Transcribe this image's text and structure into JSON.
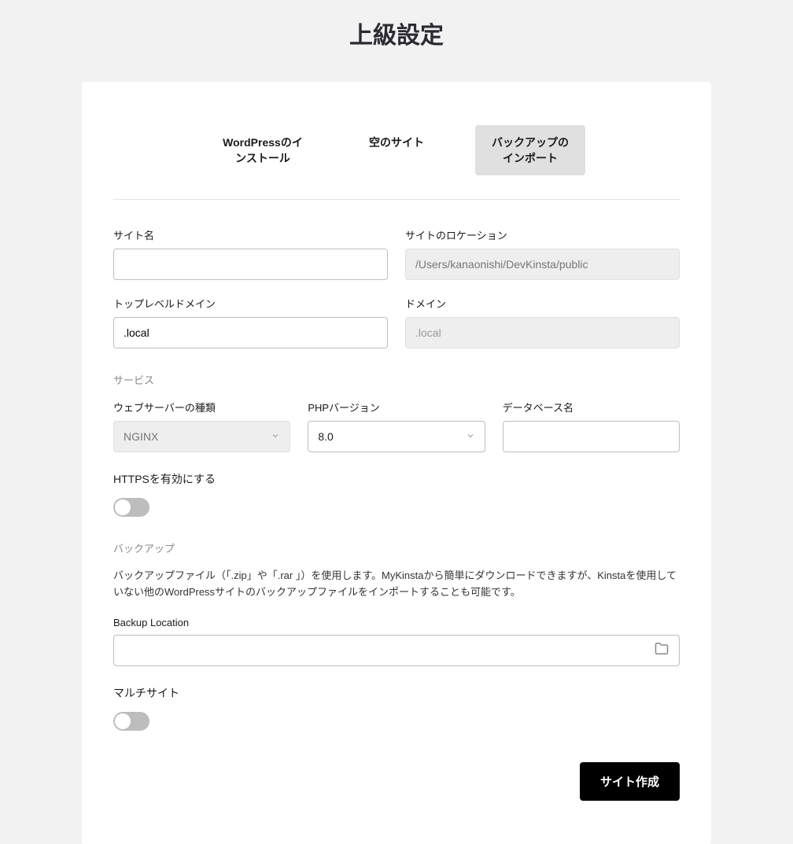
{
  "title": "上級設定",
  "tabs": {
    "wp": "WordPressのインストール",
    "empty": "空のサイト",
    "import": "バックアップのインポート"
  },
  "site_name": {
    "label": "サイト名",
    "value": ""
  },
  "site_location": {
    "label": "サイトのロケーション",
    "value": "/Users/kanaonishi/DevKinsta/public"
  },
  "tld": {
    "label": "トップレベルドメイン",
    "value": ".local"
  },
  "domain": {
    "label": "ドメイン",
    "placeholder": ".local"
  },
  "services_heading": "サービス",
  "webserver": {
    "label": "ウェブサーバーの種類",
    "value": "NGINX"
  },
  "php": {
    "label": "PHPバージョン",
    "value": "8.0"
  },
  "db": {
    "label": "データベース名",
    "value": ""
  },
  "https": {
    "label": "HTTPSを有効にする"
  },
  "backup_heading": "バックアップ",
  "backup_desc": "バックアップファイル（「.zip」や「.rar 」）を使用します。MyKinstaから簡単にダウンロードできますが、Kinstaを使用していない他のWordPressサイトのバックアップファイルをインポートすることも可能です。",
  "backup_location": {
    "label": "Backup Location",
    "value": ""
  },
  "multisite": {
    "label": "マルチサイト"
  },
  "submit": "サイト作成"
}
